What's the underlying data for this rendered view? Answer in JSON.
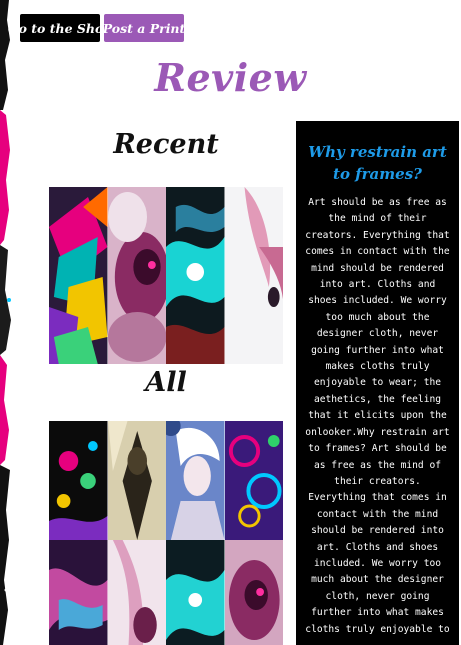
{
  "nav": {
    "shop_label": "Go to the Shop",
    "post_label": "Post a Print"
  },
  "page": {
    "title": "Review"
  },
  "sections": {
    "recent_heading": "Recent",
    "all_heading": "All"
  },
  "sidebar": {
    "title": "Why restrain art to frames?",
    "body": "Art should be as free as the mind of their creators. Everything that comes in contact with the mind should be rendered into art. Cloths and shoes included. We worry too much about the designer cloth, never going further into what makes cloths truly enjoyable to wear; the aethetics, the feeling that it elicits upon the onlooker.Why restrain art to frames? Art should be as free as the mind of their creators. Everything that comes in contact with the mind should be rendered into art. Cloths and shoes included. We worry too much about the designer cloth, never going further into what makes cloths truly enjoyable to"
  },
  "colors": {
    "accent_purple": "#9b59b6",
    "info_title_blue": "#1e9be8",
    "shop_button_bg": "#000000"
  }
}
